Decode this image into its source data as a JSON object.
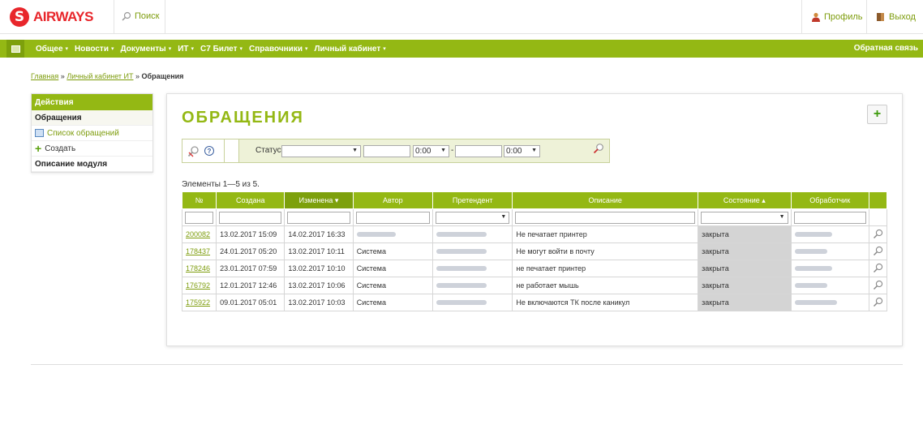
{
  "header": {
    "brand": "AIRWAYS",
    "brand_letter": "S",
    "search_label": "Поиск",
    "profile_label": "Профиль",
    "exit_label": "Выход"
  },
  "nav": {
    "items": [
      "Общее",
      "Новости",
      "Документы",
      "ИТ",
      "С7 Билет",
      "Справочники",
      "Личный кабинет"
    ],
    "caret": "▾",
    "feedback": "Обратная связь"
  },
  "breadcrumb": {
    "home": "Главная",
    "sep": "»",
    "cabinet": "Личный кабинет ИТ",
    "current": "Обращения"
  },
  "sidebar": {
    "title": "Действия",
    "items": [
      {
        "label": "Обращения"
      },
      {
        "label": "Список обращений"
      },
      {
        "label": "Создать"
      },
      {
        "label": "Описание модуля"
      }
    ]
  },
  "page": {
    "title": "ОБРАЩЕНИЯ",
    "add_label": "+",
    "count_text": "Элементы 1—5 из 5."
  },
  "filter": {
    "status_label": "Статус",
    "status_value": "",
    "time_from": "0:00",
    "time_to": "0:00",
    "dash": "-"
  },
  "table": {
    "headers": [
      "№",
      "Создана",
      "Изменена",
      "Автор",
      "Претендент",
      "Описание",
      "Состояние",
      "Обработчик"
    ],
    "rows": [
      {
        "id": "200082",
        "created": "13.02.2017 15:09",
        "modified": "14.02.2017 16:33",
        "author": "",
        "description": "Не печатает принтер",
        "state": "закрыта"
      },
      {
        "id": "178437",
        "created": "24.01.2017 05:20",
        "modified": "13.02.2017 10:11",
        "author": "Система",
        "description": "Не могут войти в почту",
        "state": "закрыта"
      },
      {
        "id": "178246",
        "created": "23.01.2017 07:59",
        "modified": "13.02.2017 10:10",
        "author": "Система",
        "description": "не печатает принтер",
        "state": "закрыта"
      },
      {
        "id": "176792",
        "created": "12.01.2017 12:46",
        "modified": "13.02.2017 10:06",
        "author": "Система",
        "description": "не работает мышь",
        "state": "закрыта"
      },
      {
        "id": "175922",
        "created": "09.01.2017 05:01",
        "modified": "13.02.2017 10:03",
        "author": "Система",
        "description": "Не включаются ТК после каникул",
        "state": "закрыта"
      }
    ]
  },
  "colors": {
    "brand_red": "#e8262b",
    "accent_green": "#94b814",
    "link_green": "#7d9c0c"
  }
}
